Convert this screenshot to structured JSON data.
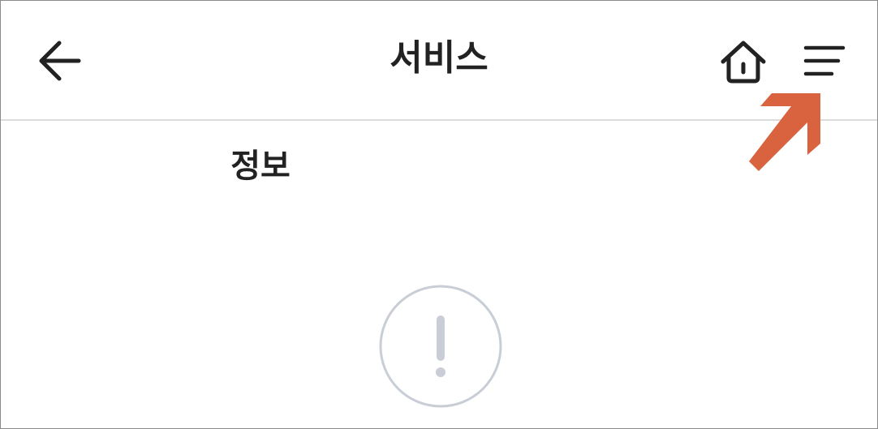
{
  "header": {
    "title": "서비스",
    "back_icon": "arrow-left-icon",
    "home_icon": "home-icon",
    "menu_icon": "hamburger-menu-icon"
  },
  "annotation": {
    "icon": "pointer-arrow-icon",
    "color": "#d9623f"
  },
  "content": {
    "section_label": "정보",
    "alert_icon": "exclamation-circle-icon"
  },
  "colors": {
    "text": "#222222",
    "divider": "#dcdcdc",
    "alert": "#c9ced6"
  }
}
